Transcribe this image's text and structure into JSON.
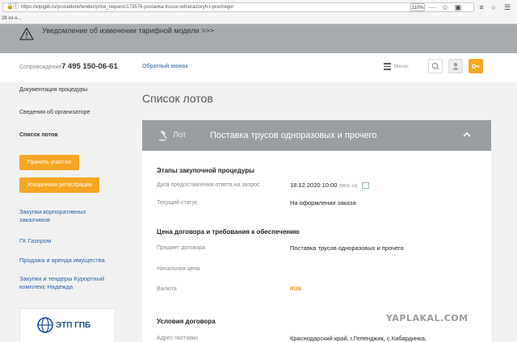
{
  "browser": {
    "url": "https://etpgpb.ru/procedure/tender/price_request/173576-postavka-trusov-odnorazovyh-i-prochego/",
    "zoom": "110%",
    "bookmark": "28 из н..."
  },
  "notice": {
    "text": "Уведомление об изменении тарифной модели >>>"
  },
  "header": {
    "support_label": "Сопровождение",
    "phone": "7 495 150-06-61",
    "callback": "Обратный звонок",
    "menu_label": "Меню"
  },
  "sidebar": {
    "items": [
      {
        "label": "Документация процедуры"
      },
      {
        "label": "Сведения об организаторе"
      },
      {
        "label": "Список лотов"
      }
    ],
    "apply_button": "Принять участие",
    "fast_register_button": "Ускоренная регистрация",
    "links": [
      {
        "label": "Закупки корпоративных заказчиков"
      },
      {
        "label": "ГК Газпром"
      },
      {
        "label": "Продажа и аренда имущества"
      },
      {
        "label": "Закупки и тендеры Курортный комплекс Надежда"
      }
    ],
    "logo_text": "ЭТП ГПБ"
  },
  "main": {
    "page_title": "Список лотов",
    "lot": {
      "label": "Лот",
      "title": "Поставка трусов одноразовых и прочего"
    },
    "sections": {
      "stages": {
        "title": "Этапы закупочной процедуры",
        "rows": [
          {
            "label": "Дата предоставления ответа на запрос",
            "value": "18.12.2020 10:00",
            "tz": "(МСК +3)"
          },
          {
            "label": "Текущий статус",
            "value": "На оформлении заказа"
          }
        ]
      },
      "price": {
        "title": "Цена договора и требования к обеспечению",
        "rows": [
          {
            "label": "Предмет договора",
            "value": "Поставка трусов одноразовых и прочего"
          },
          {
            "label": "Начальная цена",
            "value": ""
          },
          {
            "label": "Валюта",
            "value": "RUB"
          }
        ]
      },
      "conditions": {
        "title": "Условия договора",
        "rows": [
          {
            "label": "Адрес поставки",
            "value": "Краснодарский край, г.Геленджик, с.Кабардинка,"
          }
        ]
      }
    }
  },
  "watermark": "YAPLAKAL.COM",
  "colors": {
    "accent": "#f5a623",
    "link": "#2a63a8",
    "lot_header": "#9a9ea3",
    "notice": "#a7abaf"
  }
}
